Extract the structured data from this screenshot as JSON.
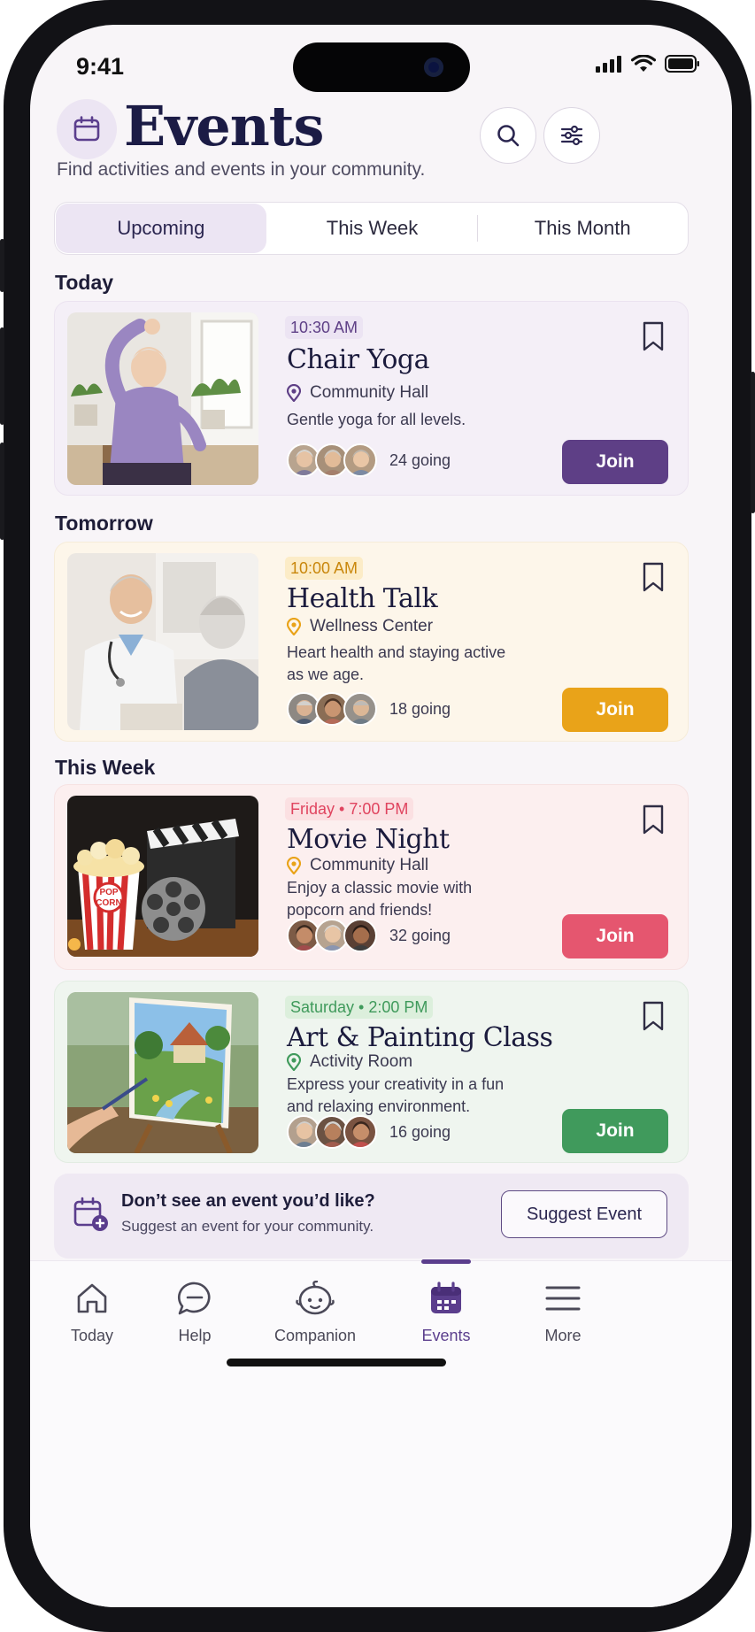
{
  "status_bar": {
    "time": "9:41"
  },
  "header": {
    "title": "Events",
    "subtitle": "Find activities and events in your community.",
    "calendar_icon": "calendar-icon",
    "search_icon": "search-icon",
    "filter_icon": "sliders-icon"
  },
  "tabs": [
    {
      "label": "Upcoming",
      "active": true
    },
    {
      "label": "This Week",
      "active": false
    },
    {
      "label": "This Month",
      "active": false
    }
  ],
  "sections": {
    "today": "Today",
    "tomorrow": "Tomorrow",
    "this_week": "This Week"
  },
  "events": [
    {
      "time": "10:30 AM",
      "title": "Chair Yoga",
      "location": "Community Hall",
      "description": "Gentle yoga for all levels.",
      "going": "24 going",
      "join_label": "Join",
      "accent": "#5e3f86",
      "card_bg": "#f4eff7"
    },
    {
      "time": "10:00 AM",
      "title": "Health Talk",
      "location": "Wellness Center",
      "description": "Heart health and staying active as we age.",
      "going": "18 going",
      "join_label": "Join",
      "accent": "#e9a319",
      "card_bg": "#fdf6ea"
    },
    {
      "time": "Friday • 7:00 PM",
      "title": "Movie Night",
      "location": "Community Hall",
      "description": "Enjoy a classic movie with popcorn and friends!",
      "going": "32 going",
      "join_label": "Join",
      "accent": "#e5566f",
      "card_bg": "#fcefef"
    },
    {
      "time": "Saturday • 2:00 PM",
      "title": "Art & Painting Class",
      "location": "Activity Room",
      "description": "Express your creativity in a fun and relaxing environment.",
      "going": "16 going",
      "join_label": "Join",
      "accent": "#409a5c",
      "card_bg": "#eff5ef"
    }
  ],
  "suggest": {
    "title": "Don’t see an event you’d like?",
    "subtitle": "Suggest an event for your community.",
    "button": "Suggest Event"
  },
  "nav": [
    {
      "label": "Today",
      "icon": "home-icon",
      "active": false
    },
    {
      "label": "Help",
      "icon": "chat-icon",
      "active": false
    },
    {
      "label": "Companion",
      "icon": "companion-face-icon",
      "active": false
    },
    {
      "label": "Events",
      "icon": "calendar-icon",
      "active": true
    },
    {
      "label": "More",
      "icon": "menu-icon",
      "active": false
    }
  ]
}
